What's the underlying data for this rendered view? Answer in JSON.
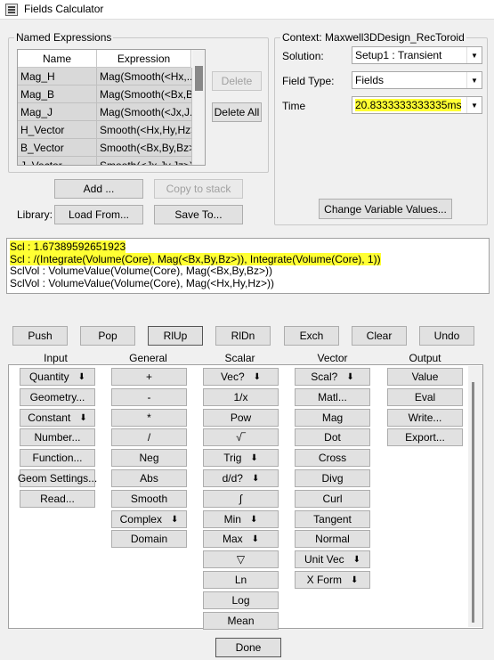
{
  "window": {
    "title": "Fields Calculator"
  },
  "named_expressions": {
    "group_label": "Named Expressions",
    "columns": [
      "Name",
      "Expression"
    ],
    "rows": [
      {
        "name": "Mag_H",
        "expression": "Mag(Smooth(<Hx,..."
      },
      {
        "name": "Mag_B",
        "expression": "Mag(Smooth(<Bx,B..."
      },
      {
        "name": "Mag_J",
        "expression": "Mag(Smooth(<Jx,J..."
      },
      {
        "name": "H_Vector",
        "expression": "Smooth(<Hx,Hy,Hz>)"
      },
      {
        "name": "B_Vector",
        "expression": "Smooth(<Bx,By,Bz>)"
      },
      {
        "name": "J_Vector",
        "expression": "Smooth(<Jx,Jy,Jz>)"
      }
    ],
    "delete_label": "Delete",
    "delete_all_label": "Delete All",
    "add_label": "Add ...",
    "copy_to_stack_label": "Copy to stack",
    "library_label": "Library:",
    "load_from_label": "Load From...",
    "save_to_label": "Save To..."
  },
  "context": {
    "group_label": "Context: Maxwell3DDesign_RecToroid",
    "solution_label": "Solution:",
    "solution_value": "Setup1 : Transient",
    "field_type_label": "Field Type:",
    "field_type_value": "Fields",
    "time_label": "Time",
    "time_value": "20.8333333333335ms",
    "change_variable_label": "Change Variable Values..."
  },
  "stack": [
    {
      "text": "Scl : 1.67389592651923",
      "highlight": true
    },
    {
      "text": "Scl : /(Integrate(Volume(Core), Mag(<Bx,By,Bz>)), Integrate(Volume(Core), 1))",
      "highlight": true
    },
    {
      "text": "SclVol : VolumeValue(Volume(Core), Mag(<Bx,By,Bz>))",
      "highlight": false
    },
    {
      "text": "SclVol : VolumeValue(Volume(Core), Mag(<Hx,Hy,Hz>))",
      "highlight": false
    }
  ],
  "stack_ops": {
    "push": "Push",
    "pop": "Pop",
    "rlup": "RlUp",
    "rldn": "RlDn",
    "exch": "Exch",
    "clear": "Clear",
    "undo": "Undo"
  },
  "columns": {
    "input": {
      "header": "Input",
      "buttons": [
        {
          "label": "Quantity",
          "arrow": true
        },
        {
          "label": "Geometry...",
          "arrow": false
        },
        {
          "label": "Constant",
          "arrow": true
        },
        {
          "label": "Number...",
          "arrow": false
        },
        {
          "label": "Function...",
          "arrow": false
        },
        {
          "label": "Geom Settings...",
          "arrow": false
        },
        {
          "label": "Read...",
          "arrow": false
        }
      ]
    },
    "general": {
      "header": "General",
      "buttons": [
        {
          "label": "+",
          "arrow": false
        },
        {
          "label": "-",
          "arrow": false
        },
        {
          "label": "*",
          "arrow": false
        },
        {
          "label": "/",
          "arrow": false
        },
        {
          "label": "Neg",
          "arrow": false
        },
        {
          "label": "Abs",
          "arrow": false
        },
        {
          "label": "Smooth",
          "arrow": false
        },
        {
          "label": "Complex",
          "arrow": true
        },
        {
          "label": "Domain",
          "arrow": false
        }
      ]
    },
    "scalar": {
      "header": "Scalar",
      "buttons": [
        {
          "label": "Vec?",
          "arrow": true
        },
        {
          "label": "1/x",
          "arrow": false
        },
        {
          "label": "Pow",
          "arrow": false
        },
        {
          "label": "√‾",
          "arrow": false
        },
        {
          "label": "Trig",
          "arrow": true
        },
        {
          "label": "d/d?",
          "arrow": true
        },
        {
          "label": "∫",
          "arrow": false
        },
        {
          "label": "Min",
          "arrow": true
        },
        {
          "label": "Max",
          "arrow": true
        },
        {
          "label": "▽",
          "arrow": false
        },
        {
          "label": "Ln",
          "arrow": false
        },
        {
          "label": "Log",
          "arrow": false
        },
        {
          "label": "Mean",
          "arrow": false
        }
      ]
    },
    "vector": {
      "header": "Vector",
      "buttons": [
        {
          "label": "Scal?",
          "arrow": true
        },
        {
          "label": "Matl...",
          "arrow": false
        },
        {
          "label": "Mag",
          "arrow": false
        },
        {
          "label": "Dot",
          "arrow": false
        },
        {
          "label": "Cross",
          "arrow": false
        },
        {
          "label": "Divg",
          "arrow": false
        },
        {
          "label": "Curl",
          "arrow": false
        },
        {
          "label": "Tangent",
          "arrow": false
        },
        {
          "label": "Normal",
          "arrow": false
        },
        {
          "label": "Unit Vec",
          "arrow": true
        },
        {
          "label": "X Form",
          "arrow": true
        }
      ]
    },
    "output": {
      "header": "Output",
      "buttons": [
        {
          "label": "Value",
          "arrow": false
        },
        {
          "label": "Eval",
          "arrow": false
        },
        {
          "label": "Write...",
          "arrow": false
        },
        {
          "label": "Export...",
          "arrow": false
        }
      ]
    }
  },
  "done_label": "Done",
  "colors": {
    "highlight": "#ffff33",
    "window_bg": "#f0f0f0",
    "button_bg": "#e1e1e1"
  }
}
